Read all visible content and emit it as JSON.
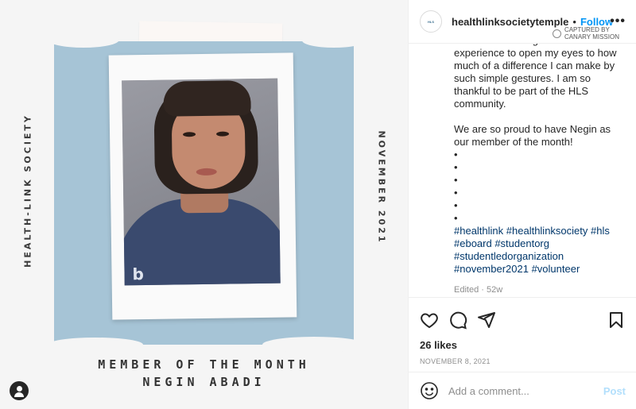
{
  "image": {
    "side_left": "HEALTH-LINK SOCIETY",
    "side_right": "NOVEMBER 2021",
    "title_line1": "MEMBER OF THE MONTH",
    "title_line2": "NEGIN ABADI",
    "panel_color": "#a6c4d6"
  },
  "header": {
    "username": "healthlinksocietytemple",
    "separator": "•",
    "follow_label": "Follow",
    "more_label": "•••",
    "watermark_line1": "CAPTURED BY",
    "watermark_line2": "CANARY MISSION"
  },
  "caption": {
    "paragraph1": "others. This club gave me this experience to open my eyes to how much of a difference I can make by such simple gestures. I am so thankful to be part of the HLS community.",
    "paragraph2": "We are so proud to have Negin as our member of the month!",
    "bullets": [
      "•",
      "•",
      "•",
      "•",
      "•",
      "•"
    ],
    "hashtags": "#healthlink #healthlinksociety #hls #eboard #studentorg #studentledorganization #november2021 #volunteer",
    "edited": "Edited · 52w"
  },
  "actions": {
    "likes": "26 likes",
    "date": "NOVEMBER 8, 2021"
  },
  "comment": {
    "placeholder": "Add a comment...",
    "post_label": "Post"
  },
  "colors": {
    "accent": "#0095f6",
    "hashtag": "#00376b",
    "post_disabled": "#b2dffc"
  }
}
